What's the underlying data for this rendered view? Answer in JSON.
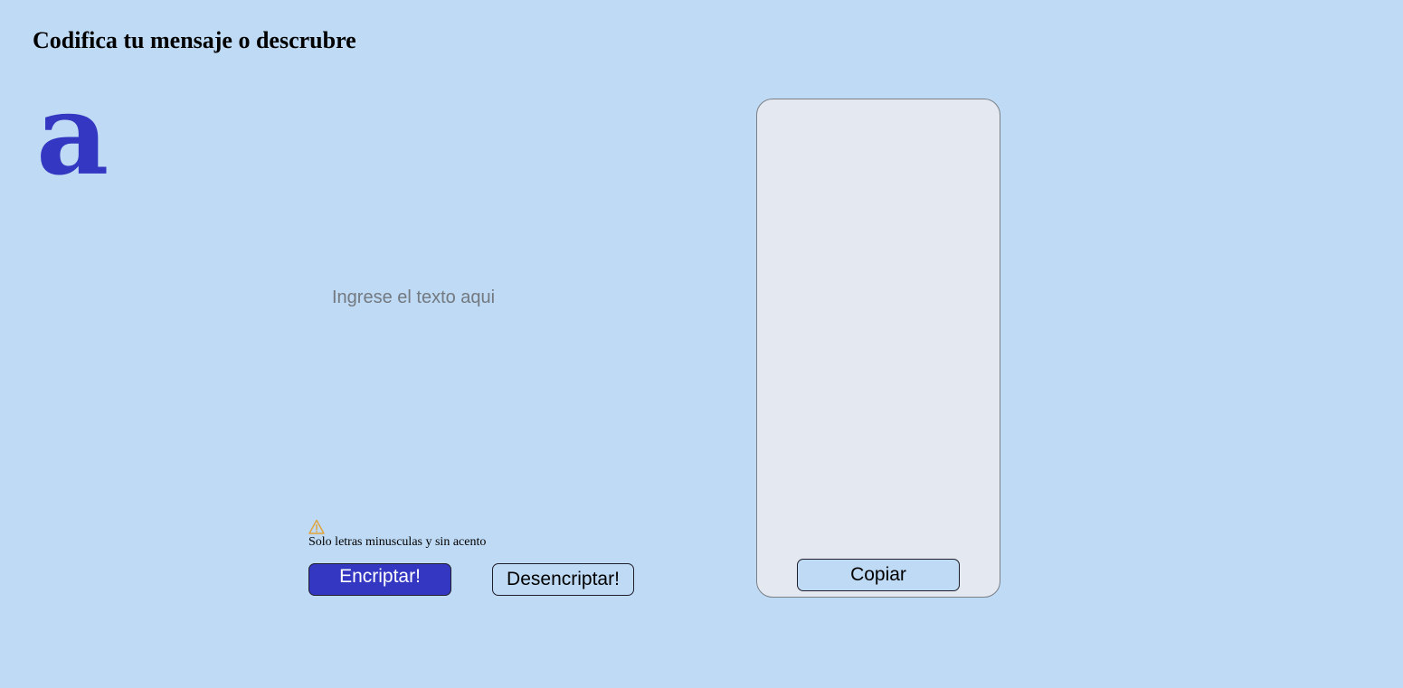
{
  "header": {
    "title": "Codifica tu mensaje o descrubre"
  },
  "logo": {
    "letter": "a",
    "color": "#3337c2"
  },
  "input": {
    "placeholder": "Ingrese el texto aqui",
    "value": ""
  },
  "warning": {
    "icon": "warning-triangle-icon",
    "text": "Solo letras minusculas y sin acento",
    "color": "#e0a23a"
  },
  "actions": {
    "encrypt_label": "Encriptar!",
    "decrypt_label": "Desencriptar!"
  },
  "output": {
    "value": "",
    "copy_label": "Copiar"
  },
  "colors": {
    "background": "#bfdaf4",
    "accent": "#3337c2",
    "panel": "#e4e9f1"
  }
}
